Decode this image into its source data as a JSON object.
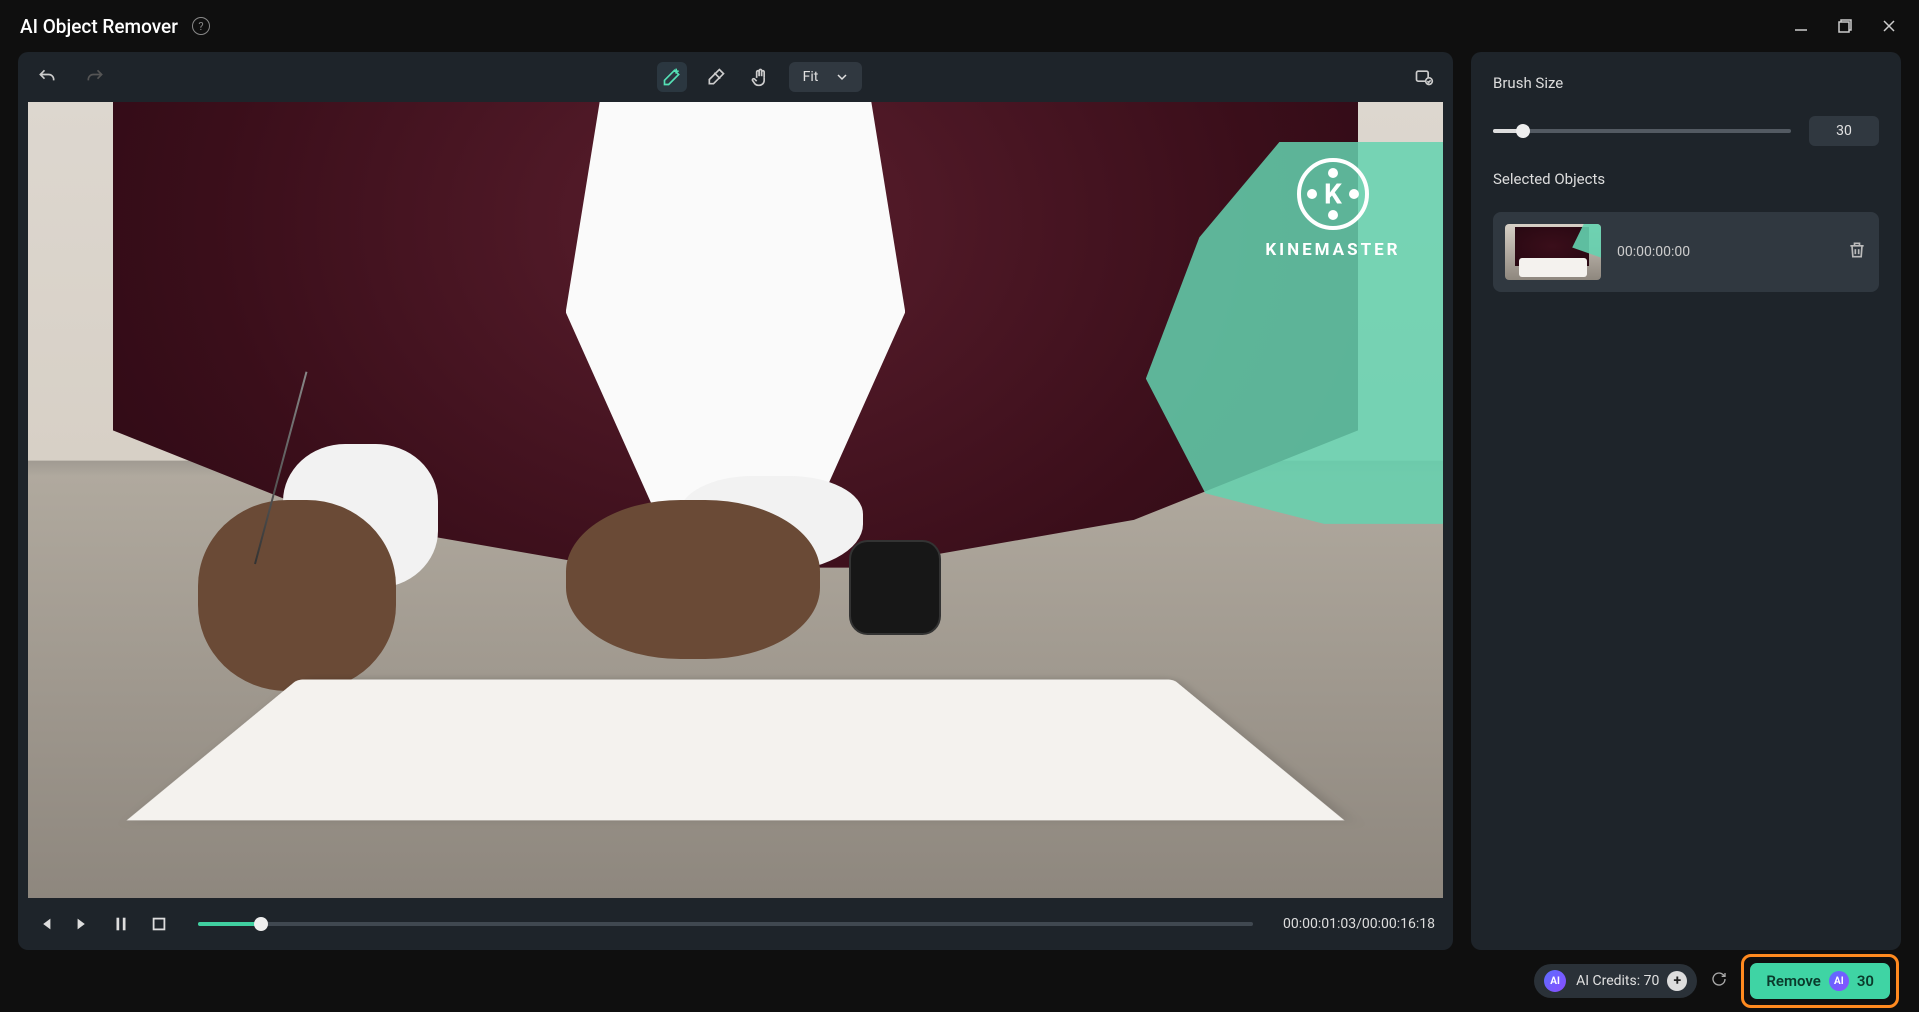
{
  "app": {
    "title": "AI Object Remover"
  },
  "toolbar": {
    "zoom_label": "Fit"
  },
  "watermark": {
    "letter": "K",
    "brand": "KINEMASTER"
  },
  "playbar": {
    "current_time": "00:00:01:03",
    "total_time": "00:00:16:18"
  },
  "sidebar": {
    "brush_size_label": "Brush Size",
    "brush_size_value": "30",
    "selected_objects_label": "Selected Objects",
    "objects": [
      {
        "timecode": "00:00:00:00"
      }
    ]
  },
  "footer": {
    "ai_badge": "AI",
    "credits_label": "AI Credits: ",
    "credits_value": "70",
    "plus": "+",
    "remove_label": "Remove",
    "remove_cost": "30"
  }
}
